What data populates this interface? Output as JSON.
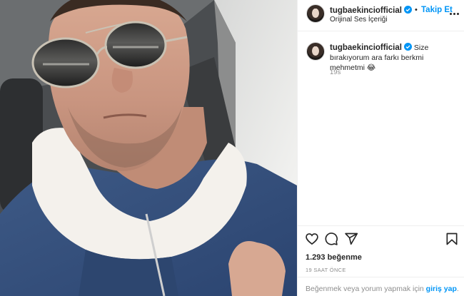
{
  "post": {
    "username": "tugbaekinciofficial",
    "verified": true,
    "separator": "•",
    "follow_label": "Takip Et",
    "audio_label": "Orijinal Ses İçeriği",
    "more_icon": "more-horizontal-icon"
  },
  "caption": {
    "username": "tugbaekinciofficial",
    "text": "Size bırakıyorum ara farkı berkmi mehmetmi 😂",
    "time_ago": "19s"
  },
  "actions": {
    "icons": [
      "heart-icon",
      "comment-icon",
      "share-icon",
      "bookmark-icon"
    ]
  },
  "stats": {
    "likes": "1.293 beğenme",
    "timestamp": "19 SAAT ÖNCE"
  },
  "footer": {
    "prefix": "Beğenmek veya yorum yapmak için",
    "login_label": "giriş yap",
    "suffix": "."
  },
  "colors": {
    "accent": "#0095f6",
    "text": "#262626",
    "muted": "#8e8e8e",
    "border": "#efefef"
  }
}
